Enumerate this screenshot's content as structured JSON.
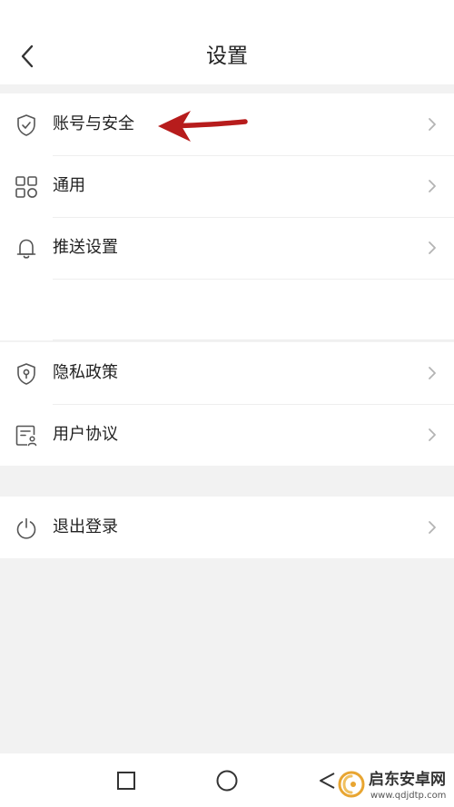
{
  "header": {
    "title": "设置",
    "back_icon": "chevron-left-icon"
  },
  "groups": [
    {
      "items": [
        {
          "label": "账号与安全",
          "icon": "shield-check-icon"
        },
        {
          "label": "通用",
          "icon": "grid-icon"
        },
        {
          "label": "推送设置",
          "icon": "bell-icon"
        }
      ]
    },
    {
      "items": [
        {
          "label": "隐私政策",
          "icon": "shield-lock-icon"
        },
        {
          "label": "用户协议",
          "icon": "document-user-icon"
        }
      ]
    },
    {
      "items": [
        {
          "label": "退出登录",
          "icon": "power-icon"
        }
      ]
    }
  ],
  "annotation": {
    "arrow_color": "#b71c1c",
    "points_to": "账号与安全"
  },
  "nav_bar": {
    "buttons": [
      "square-icon",
      "circle-icon",
      "triangle-back-icon"
    ]
  },
  "watermark": {
    "title": "启东安卓网",
    "url": "www.qdjdtp.com",
    "accent": "#e8a531"
  },
  "colors": {
    "background": "#f2f2f2",
    "surface": "#ffffff",
    "text": "#222222",
    "icon": "#555555",
    "chevron": "#b3b3b3"
  }
}
